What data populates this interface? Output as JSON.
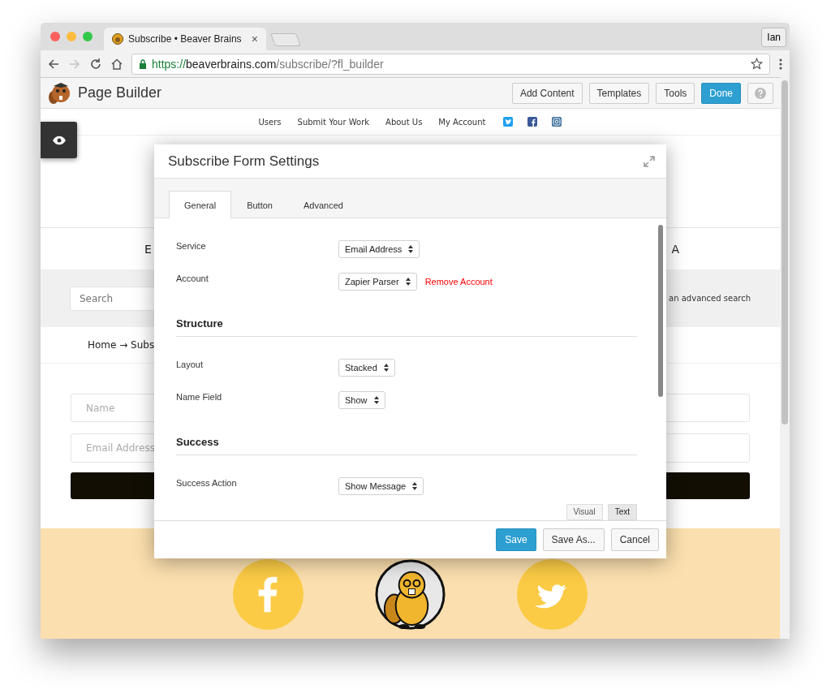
{
  "browser": {
    "tab": {
      "title": "Subscribe • Beaver Brains",
      "close": "×"
    },
    "profile": "Ian",
    "forward_disabled": true,
    "url": {
      "scheme": "https://",
      "host": "beaverbrains.com",
      "path": "/subscribe/?fl_builder"
    }
  },
  "builder_bar": {
    "title": "Page Builder",
    "buttons": [
      {
        "label": "Add Content",
        "kind": "default"
      },
      {
        "label": "Templates",
        "kind": "default"
      },
      {
        "label": "Tools",
        "kind": "default"
      },
      {
        "label": "Done",
        "kind": "primary"
      }
    ]
  },
  "site": {
    "nav": [
      "Users",
      "Submit Your Work",
      "About Us",
      "My Account"
    ],
    "heading_left": "E",
    "heading_right": "A",
    "search": {
      "placeholder": "Search"
    },
    "search_hint": "an advanced search",
    "breadcrumb": "Home → Subs",
    "form": {
      "fields": [
        {
          "placeholder": "Name"
        },
        {
          "placeholder": "Email Address"
        }
      ]
    }
  },
  "modal": {
    "title": "Subscribe Form Settings",
    "tabs": [
      {
        "label": "General",
        "selected": true
      },
      {
        "label": "Button",
        "selected": false
      },
      {
        "label": "Advanced",
        "selected": false
      }
    ],
    "sections": [
      {
        "rows": [
          {
            "label": "Service",
            "value": "Email Address"
          },
          {
            "label": "Account",
            "value": "Zapier Parser",
            "action": "Remove Account"
          }
        ]
      },
      {
        "heading": "Structure",
        "rows": [
          {
            "label": "Layout",
            "value": "Stacked"
          },
          {
            "label": "Name Field",
            "value": "Show"
          }
        ]
      },
      {
        "heading": "Success",
        "rows": [
          {
            "label": "Success Action",
            "value": "Show Message"
          }
        ]
      }
    ],
    "editor_tabs": [
      {
        "label": "Visual",
        "selected": false
      },
      {
        "label": "Text",
        "selected": true
      }
    ],
    "buttons": [
      {
        "label": "Save",
        "kind": "primary"
      },
      {
        "label": "Save As...",
        "kind": "default"
      },
      {
        "label": "Cancel",
        "kind": "default"
      }
    ]
  }
}
